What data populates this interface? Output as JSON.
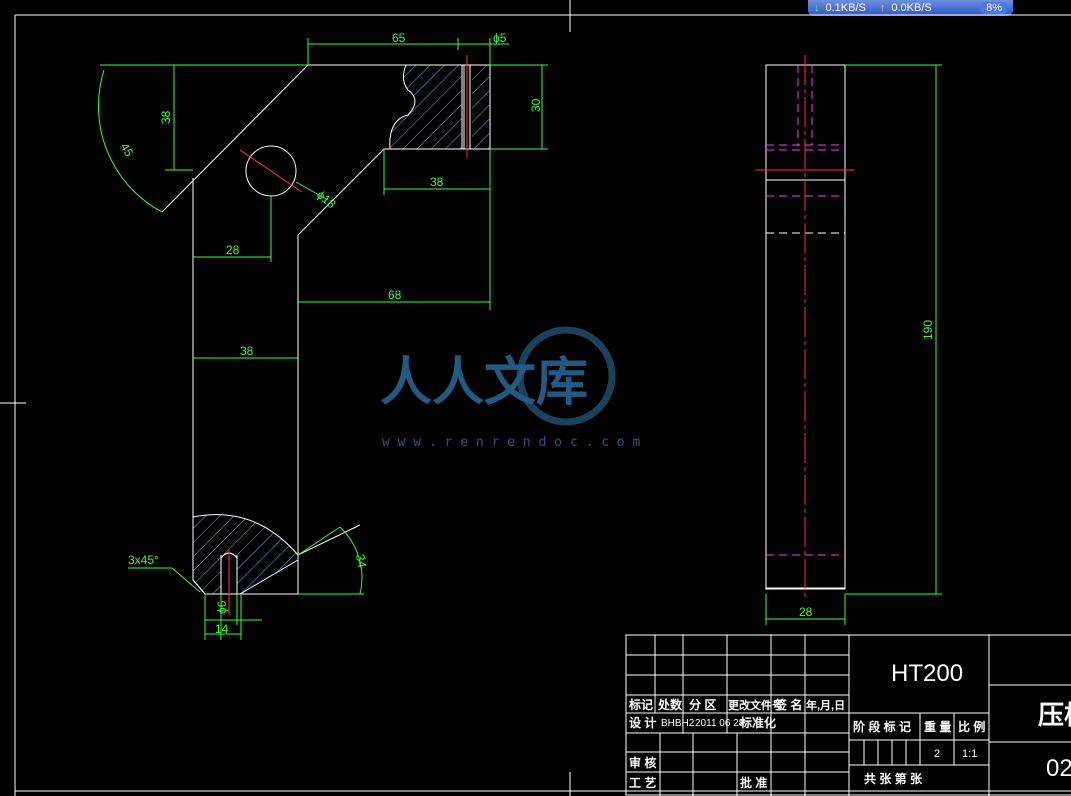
{
  "network_widget": {
    "download": "0.1KB/S",
    "upload": "0.0KB/S",
    "cpu": "8%"
  },
  "watermark": {
    "brand": "人人文库",
    "url": "w w w . r e n r e n d o c . c o m"
  },
  "front_view_dims": {
    "d65": "65",
    "d5": "ϕ5",
    "d30": "30",
    "d38v": "38",
    "d45": "45",
    "d18": "ϕ18",
    "d38h": "38",
    "d28": "28",
    "d68": "68",
    "d38b": "38",
    "chamfer": "3x45°",
    "d34": "34",
    "d6": "ϕ6",
    "d14": "14"
  },
  "side_view_dims": {
    "d190": "190",
    "d28": "28"
  },
  "title_block": {
    "material": "HT200",
    "part_name": "压板",
    "drawing_no": "02",
    "rev_headers": [
      "标记",
      "处数",
      "分 区",
      "更改文件号",
      "签 名",
      "年,月,日"
    ],
    "design_label": "设 计",
    "designer": "BHBH2",
    "design_date": "2011 06 28",
    "standardize": "标准化",
    "review": "审 核",
    "process": "工 艺",
    "approve": "批 准",
    "stage_headers": [
      "阶 段 标 记",
      "重 量",
      "比 例"
    ],
    "weight": "2",
    "scale": "1:1",
    "sheets": "共 张 第 张"
  },
  "colors": {
    "background": "#000000",
    "outline": "#ffffff",
    "dimension": "#33ff33",
    "centerline": "#ff3333",
    "hidden": "#ff33ff"
  }
}
